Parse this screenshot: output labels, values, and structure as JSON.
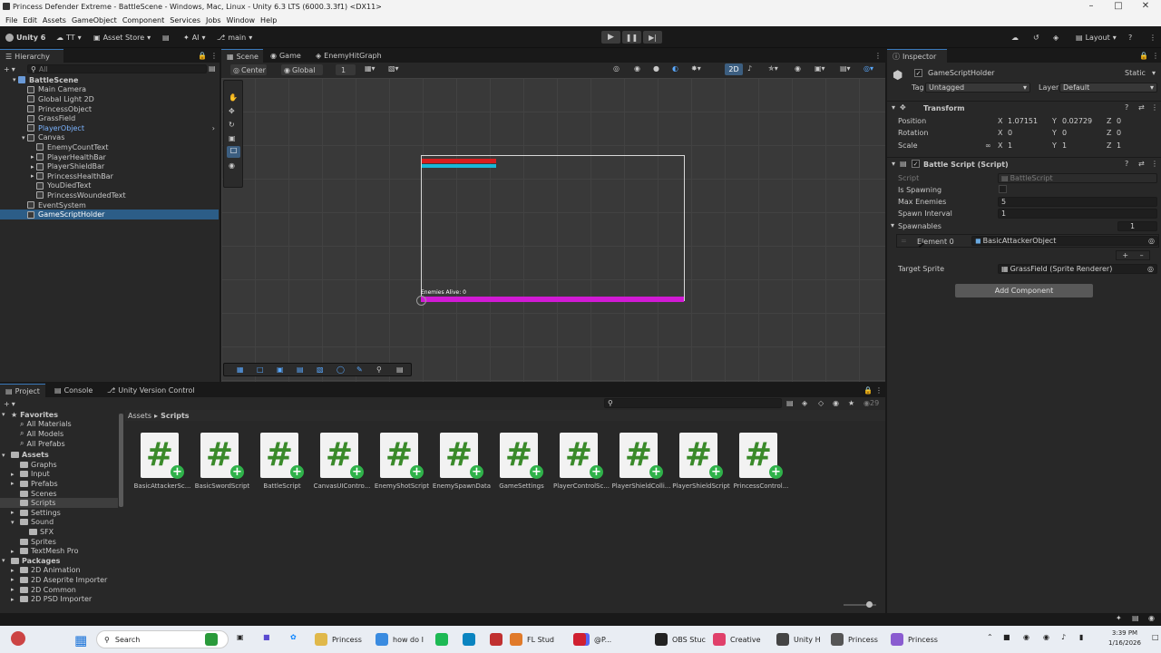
{
  "window": {
    "title": "Princess Defender Extreme - BattleScene - Windows, Mac, Linux - Unity 6.3 LTS (6000.3.3f1) <DX11>"
  },
  "menu": [
    "File",
    "Edit",
    "Assets",
    "GameObject",
    "Component",
    "Services",
    "Jobs",
    "Window",
    "Help"
  ],
  "toolbar": {
    "account": "Unity 6",
    "tt": "TT",
    "asset_store": "Asset Store",
    "ai": "AI",
    "branch": "main",
    "layout": "Layout"
  },
  "hierarchy": {
    "tab": "Hierarchy",
    "search_placeholder": "All",
    "items": [
      {
        "label": "BattleScene",
        "depth": 0,
        "type": "scene"
      },
      {
        "label": "Main Camera",
        "depth": 1
      },
      {
        "label": "Global Light 2D",
        "depth": 1
      },
      {
        "label": "PrincessObject",
        "depth": 1
      },
      {
        "label": "GrassField",
        "depth": 1
      },
      {
        "label": "PlayerObject",
        "depth": 1,
        "highlight": true
      },
      {
        "label": "Canvas",
        "depth": 1,
        "expanded": true
      },
      {
        "label": "EnemyCountText",
        "depth": 2
      },
      {
        "label": "PlayerHealthBar",
        "depth": 2,
        "arrow": true
      },
      {
        "label": "PlayerShieldBar",
        "depth": 2,
        "arrow": true
      },
      {
        "label": "PrincessHealthBar",
        "depth": 2,
        "arrow": true
      },
      {
        "label": "YouDiedText",
        "depth": 2
      },
      {
        "label": "PrincessWoundedText",
        "depth": 2
      },
      {
        "label": "EventSystem",
        "depth": 1
      },
      {
        "label": "GameScriptHolder",
        "depth": 1,
        "selected": true
      }
    ]
  },
  "scene": {
    "tabs": [
      "Scene",
      "Game",
      "EnemyHitGraph"
    ],
    "pivot": "Center",
    "space": "Global",
    "grid_snap": "1",
    "mode_2d": "2D",
    "enemy_label": "Enemies Alive: 0"
  },
  "inspector": {
    "tab": "Inspector",
    "object_name": "GameScriptHolder",
    "static_label": "Static",
    "tag_label": "Tag",
    "tag_value": "Untagged",
    "layer_label": "Layer",
    "layer_value": "Default",
    "transform": {
      "header": "Transform",
      "position": {
        "label": "Position",
        "x": "1.07151",
        "y": "0.02729",
        "z": "0"
      },
      "rotation": {
        "label": "Rotation",
        "x": "0",
        "y": "0",
        "z": "0"
      },
      "scale": {
        "label": "Scale",
        "x": "1",
        "y": "1",
        "z": "1"
      }
    },
    "script_comp": {
      "header": "Battle Script (Script)",
      "script_label": "Script",
      "script_value": "BattleScript",
      "is_spawning_label": "Is Spawning",
      "max_enemies_label": "Max Enemies",
      "max_enemies_value": "5",
      "spawn_interval_label": "Spawn Interval",
      "spawn_interval_value": "1",
      "spawnables_label": "Spawnables",
      "spawnables_count": "1",
      "element0_label": "Element 0",
      "element0_value": "BasicAttackerObject",
      "target_sprite_label": "Target Sprite",
      "target_sprite_value": "GrassField (Sprite Renderer)"
    },
    "add_component": "Add Component",
    "axis": {
      "x": "X",
      "y": "Y",
      "z": "Z"
    }
  },
  "project": {
    "tabs": [
      "Project",
      "Console",
      "Unity Version Control"
    ],
    "breadcrumb": [
      "Assets",
      "Scripts"
    ],
    "count": "29",
    "favorites": {
      "header": "Favorites",
      "items": [
        "All Materials",
        "All Models",
        "All Prefabs"
      ]
    },
    "assets": {
      "header": "Assets",
      "items": [
        {
          "label": "Graphs",
          "depth": 1
        },
        {
          "label": "Input",
          "depth": 1
        },
        {
          "label": "Prefabs",
          "depth": 1
        },
        {
          "label": "Scenes",
          "depth": 1
        },
        {
          "label": "Scripts",
          "depth": 1,
          "selected": true
        },
        {
          "label": "Settings",
          "depth": 1
        },
        {
          "label": "Sound",
          "depth": 1
        },
        {
          "label": "SFX",
          "depth": 2
        },
        {
          "label": "Sprites",
          "depth": 1
        },
        {
          "label": "TextMesh Pro",
          "depth": 1
        }
      ]
    },
    "packages": {
      "header": "Packages",
      "items": [
        "2D Animation",
        "2D Aseprite Importer",
        "2D Common",
        "2D PSD Importer"
      ]
    },
    "files": [
      "BasicAttackerSc...",
      "BasicSwordScript",
      "BattleScript",
      "CanvasUIContro...",
      "EnemyShotScript",
      "EnemySpawnData",
      "GameSettings",
      "PlayerControlSc...",
      "PlayerShieldColli...",
      "PlayerShieldScript",
      "PrincessControl..."
    ]
  },
  "taskbar": {
    "search": "Search",
    "apps": [
      {
        "label": "Princess",
        "color": "#e0b84a"
      },
      {
        "label": "how do I",
        "color": "#3a8be0"
      },
      {
        "label": "FL Stud",
        "color": "#e07a2a"
      },
      {
        "label": "@P...",
        "color": "#5865f2"
      },
      {
        "label": "OBS Stuc",
        "color": "#222222"
      },
      {
        "label": "Creative",
        "color": "#e0406a"
      },
      {
        "label": "Unity H",
        "color": "#444444"
      },
      {
        "label": "Princess",
        "color": "#555555"
      },
      {
        "label": "Princess",
        "color": "#8a5cd0"
      }
    ],
    "time": "3:39 PM",
    "date": "1/16/2026"
  }
}
